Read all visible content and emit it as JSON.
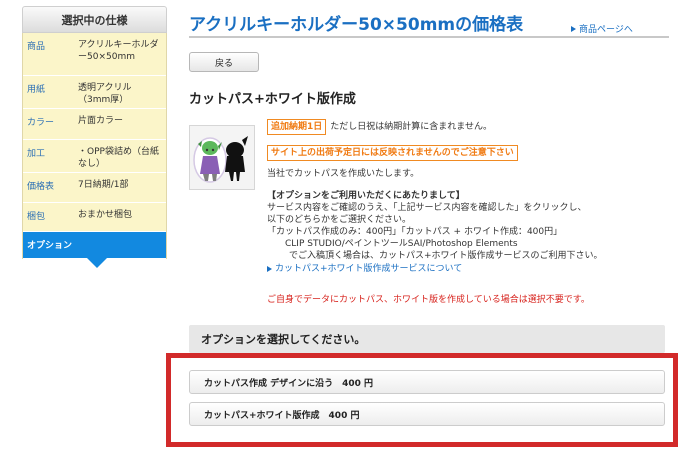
{
  "sidebar": {
    "heading": "選択中の仕様",
    "rows": [
      {
        "key": "商品",
        "value": "アクリルキーホルダー50×50mm"
      },
      {
        "key": "用紙",
        "value": "透明アクリル（3mm厚）"
      },
      {
        "key": "カラー",
        "value": "片面カラー"
      },
      {
        "key": "加工",
        "value": "・OPP袋詰め（台紙なし）"
      },
      {
        "key": "価格表",
        "value": "7日納期/1部"
      },
      {
        "key": "梱包",
        "value": "おまかせ梱包"
      }
    ],
    "active_label": "オプション"
  },
  "header": {
    "title": "アクリルキーホルダー50×50mmの価格表",
    "product_link": "商品ページへ"
  },
  "back_button": "戻る",
  "section_title": "カットパス+ホワイト版作成",
  "info": {
    "badge_lead_time": "追加納期1日",
    "lead_time_note": "ただし日祝は納期計算に含まれません。",
    "badge_warning": "サイト上の出荷予定日には反映されませんのでご注意下さい",
    "desc": "当社でカットパスを作成いたします。",
    "usage_heading": "【オプションをご利用いただくにあたりまして】",
    "usage_lines": [
      "サービス内容をご確認のうえ、「上記サービス内容を確認した」をクリックし、",
      "以下のどちらかをご選択ください。",
      "「カットパス作成のみ：400円」「カットパス + ホワイト作成：400円」",
      "CLIP STUDIO/ペイントツールSAI/Photoshop Elements",
      "でご入稿頂く場合は、カットパス+ホワイト版作成サービスのご利用下さい。"
    ],
    "service_link": "カットパス+ホワイト版作成サービスについて",
    "red_note": "ご自身でデータにカットパス、ホワイト版を作成している場合は選択不要です。"
  },
  "options": {
    "heading": "オプションを選択してください。",
    "items": [
      "カットパス作成 デザインに沿う　400 円",
      "カットパス+ホワイト版作成　400 円"
    ]
  },
  "colors": {
    "accent_blue": "#1a6fc2",
    "sidebar_active": "#1289e0",
    "sidebar_bg": "#fbf5c9",
    "badge_orange": "#f07a12",
    "note_red": "#d7221c",
    "highlight_frame": "#d22a2a"
  }
}
